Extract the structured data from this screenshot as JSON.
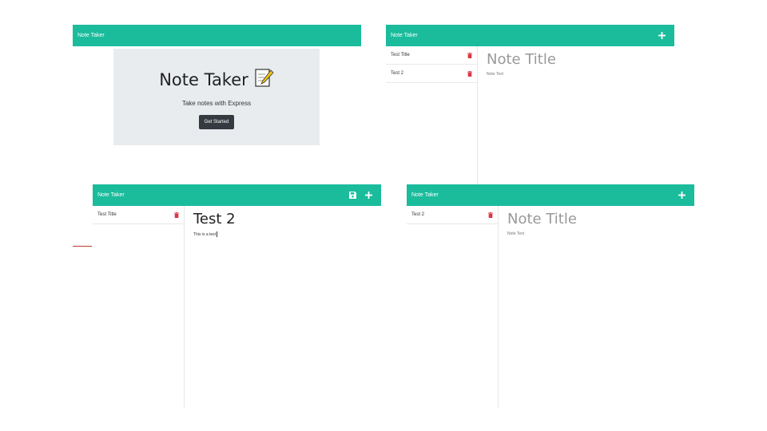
{
  "app": {
    "brand": "Note Taker"
  },
  "landing": {
    "title": "Note Taker",
    "title_icon": "memo-icon",
    "subtitle": "Take notes with Express",
    "button_label": "Get Started"
  },
  "view_notes": {
    "list": [
      {
        "title": "Test Title"
      },
      {
        "title": "Test 2"
      }
    ],
    "note": {
      "title": "Note Title",
      "text": "Note Text"
    }
  },
  "new_note": {
    "list": [
      {
        "title": "Test Title"
      }
    ],
    "note": {
      "title": "Test 2",
      "text": "This is a test"
    }
  },
  "saved_view": {
    "list": [
      {
        "title": "Test 2"
      }
    ],
    "note": {
      "title": "Note Title",
      "text": "Note Text"
    }
  },
  "colors": {
    "navbar": "#1abc9c",
    "jumbotron": "#e9ecef",
    "button": "#343a40",
    "trash": "#dc3545",
    "accent_line": "#c0392b"
  }
}
